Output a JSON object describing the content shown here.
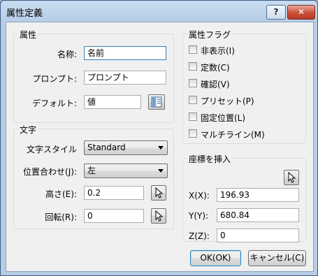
{
  "window": {
    "title": "属性定義",
    "help_label": "?",
    "close_label": "✕"
  },
  "attribute": {
    "group_label": "属性",
    "name_label": "名称:",
    "name_value": "名前",
    "prompt_label": "プロンプト:",
    "prompt_value": "プロンプト",
    "default_label": "デフォルト:",
    "default_value": "値"
  },
  "flags": {
    "group_label": "属性フラグ",
    "items": [
      {
        "label": "非表示(I)",
        "checked": false
      },
      {
        "label": "定数(C)",
        "checked": false
      },
      {
        "label": "確認(V)",
        "checked": false
      },
      {
        "label": "プリセット(P)",
        "checked": false
      },
      {
        "label": "固定位置(L)",
        "checked": false
      },
      {
        "label": "マルチライン(M)",
        "checked": false
      }
    ]
  },
  "text": {
    "group_label": "文字",
    "style_label": "文字スタイル",
    "style_value": "Standard",
    "justify_label": "位置合わせ(J):",
    "justify_value": "左",
    "height_label": "高さ(E):",
    "height_value": "0.2",
    "rotation_label": "回転(R):",
    "rotation_value": "0"
  },
  "insert": {
    "group_label": "座標を挿入",
    "x_label": "X(X):",
    "x_value": "196.93",
    "y_label": "Y(Y):",
    "y_value": "680.84",
    "z_label": "Z(Z):",
    "z_value": "0"
  },
  "buttons": {
    "ok_label": "OK(OK)",
    "cancel_label": "キャンセル(C)"
  },
  "icons": {
    "field_picker": "field-insert-icon",
    "pick_point": "cursor-pick-icon"
  }
}
